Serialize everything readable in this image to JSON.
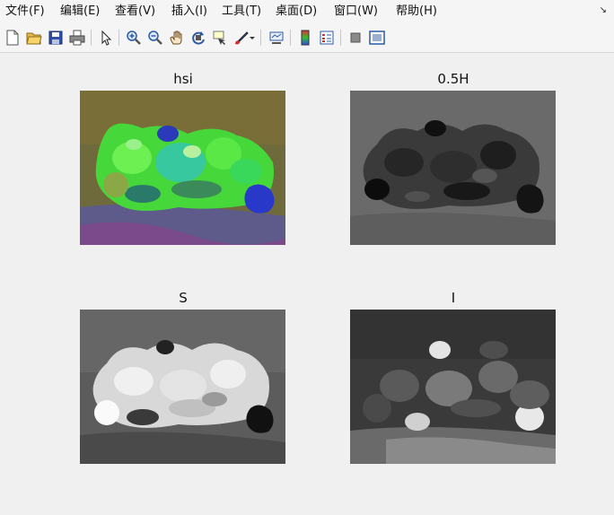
{
  "menu": {
    "items": [
      "文件(F)",
      "编辑(E)",
      "查看(V)",
      "插入(I)",
      "工具(T)",
      "桌面(D)",
      "窗口(W)",
      "帮助(H)"
    ],
    "overflow_icon": "corner-arrow-icon"
  },
  "toolbar": {
    "buttons": [
      "new-figure-icon",
      "open-file-icon",
      "save-icon",
      "print-icon",
      "edit-plot-arrow-icon",
      "zoom-in-icon",
      "zoom-out-icon",
      "pan-hand-icon",
      "rotate-3d-icon",
      "data-cursor-icon",
      "brush-icon",
      "link-plot-icon",
      "colorbar-icon",
      "legend-icon",
      "hide-plot-tools-icon",
      "show-plot-tools-icon"
    ]
  },
  "axes": [
    {
      "title": "hsi"
    },
    {
      "title": "0.5H"
    },
    {
      "title": "S"
    },
    {
      "title": "I"
    }
  ]
}
